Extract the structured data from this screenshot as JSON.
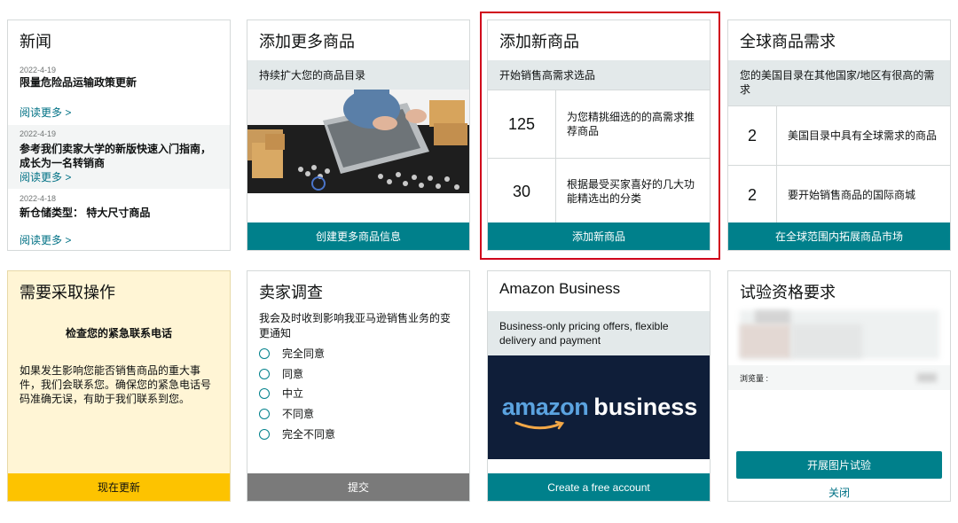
{
  "news": {
    "title": "新闻",
    "items": [
      {
        "date": "2022-4-19",
        "title": "限量危险品运输政策更新",
        "link": "阅读更多 >"
      },
      {
        "date": "2022-4-19",
        "title": "参考我们卖家大学的新版快速入门指南，成长为一名转销商",
        "link": "阅读更多 >"
      },
      {
        "date": "2022-4-18",
        "title": "新仓储类型： 特大尺寸商品",
        "link": "阅读更多 >"
      }
    ]
  },
  "add_more": {
    "title": "添加更多商品",
    "subtitle": "持续扩大您的商品目录",
    "button": "创建更多商品信息"
  },
  "add_new": {
    "title": "添加新商品",
    "subtitle": "开始销售高需求选品",
    "rows": [
      {
        "num": "125",
        "text": "为您精挑细选的的高需求推荐商品"
      },
      {
        "num": "30",
        "text": "根据最受买家喜好的几大功能精选出的分类"
      }
    ],
    "button": "添加新商品"
  },
  "global": {
    "title": "全球商品需求",
    "subtitle": "您的美国目录在其他国家/地区有很高的需求",
    "rows": [
      {
        "num": "2",
        "text": "美国目录中具有全球需求的商品"
      },
      {
        "num": "2",
        "text": "要开始销售商品的国际商城"
      }
    ],
    "button": "在全球范围内拓展商品市场"
  },
  "action": {
    "title": "需要采取操作",
    "heading": "检查您的紧急联系电话",
    "body": "如果发生影响您能否销售商品的重大事件，我们会联系您。确保您的紧急电话号码准确无误，有助于我们联系到您。",
    "button": "现在更新"
  },
  "survey": {
    "title": "卖家调查",
    "question": "我会及时收到影响我亚马逊销售业务的变更通知",
    "options": [
      "完全同意",
      "同意",
      "中立",
      "不同意",
      "完全不同意"
    ],
    "button": "提交"
  },
  "business": {
    "title": "Amazon Business",
    "subtitle": "Business-only pricing offers, flexible delivery and payment",
    "logo_word1": "amazon",
    "logo_word2": "business",
    "button": "Create a free account"
  },
  "trial": {
    "title": "试验资格要求",
    "views_label": "浏览量 :",
    "button": "开展图片试验",
    "close": "关闭"
  },
  "colors": {
    "teal": "#00808b",
    "link": "#007185",
    "yellow": "#fdc300",
    "highlight": "#d0021b",
    "navy": "#0f1e39"
  }
}
